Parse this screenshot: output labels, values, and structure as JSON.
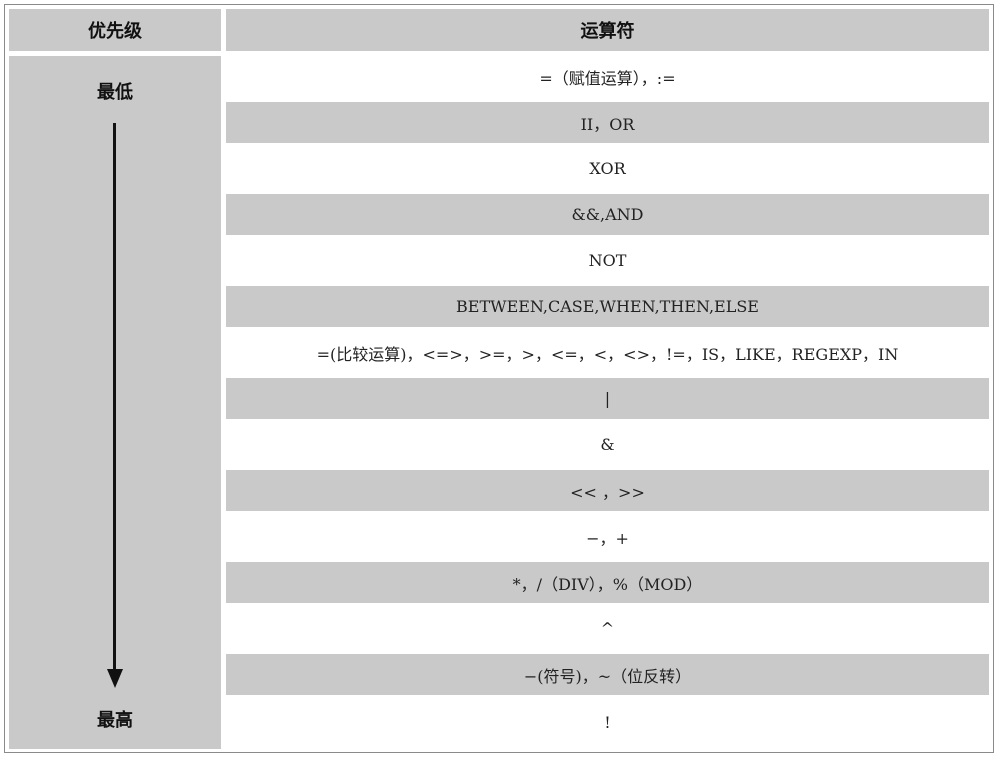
{
  "header": {
    "priority_label": "优先级",
    "operator_label": "运算符"
  },
  "priority": {
    "lowest": "最低",
    "highest": "最高"
  },
  "rows": [
    "=（赋值运算），:=",
    "II，OR",
    "XOR",
    "&&,AND",
    "NOT",
    "BETWEEN,CASE,WHEN,THEN,ELSE",
    "=(比较运算)，<=>，>=，>，<=，<，<>，!=，IS，LIKE，REGEXP，IN",
    "|",
    "&",
    "<< ，>>",
    "−，+",
    "*，/（DIV），%（MOD）",
    "^",
    "−(符号)，~（位反转）",
    "!"
  ],
  "colors": {
    "band_gray": "#c9c9c9",
    "band_white": "#ffffff",
    "arrow": "#111111"
  }
}
